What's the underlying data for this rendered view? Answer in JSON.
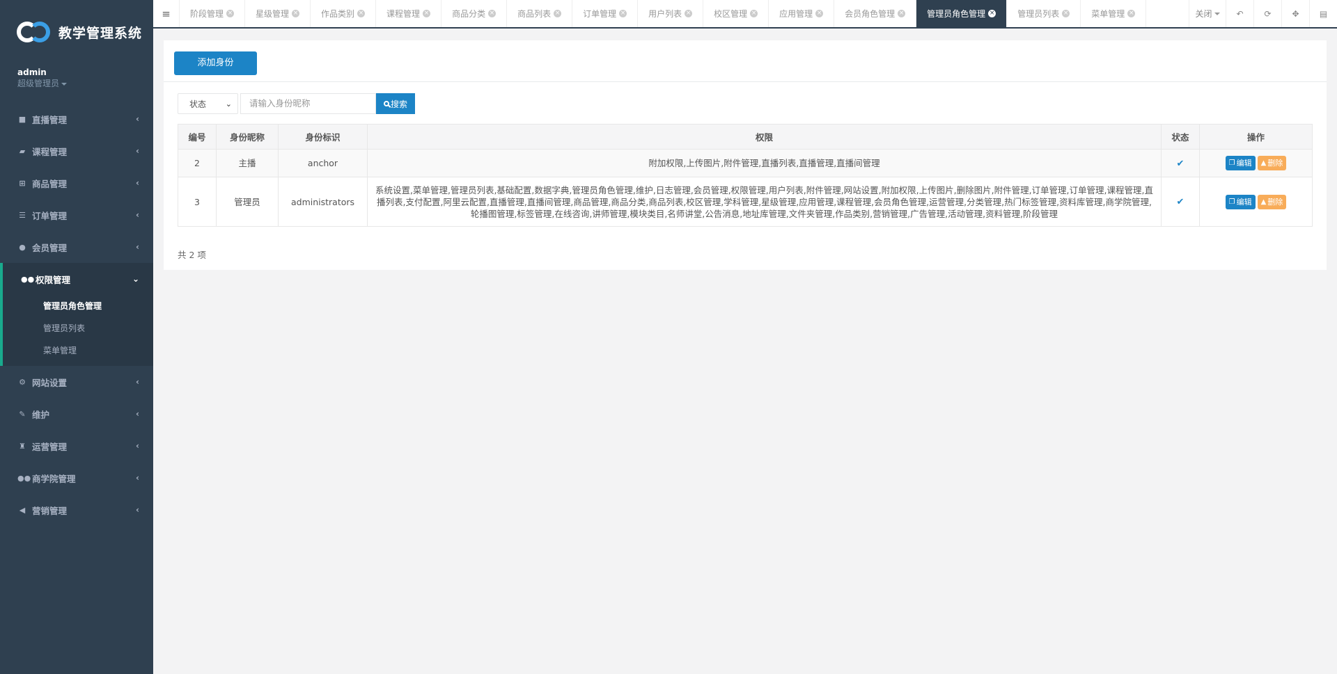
{
  "app": {
    "title": "教学管理系统"
  },
  "user": {
    "name": "admin",
    "role": "超级管理员"
  },
  "sidebar": {
    "items": [
      {
        "label": "直播管理",
        "icon": "video-icon"
      },
      {
        "label": "课程管理",
        "icon": "book-icon"
      },
      {
        "label": "商品管理",
        "icon": "cart-icon"
      },
      {
        "label": "订单管理",
        "icon": "list-icon"
      },
      {
        "label": "会员管理",
        "icon": "user-icon"
      },
      {
        "label": "权限管理",
        "icon": "users-icon"
      },
      {
        "label": "网站设置",
        "icon": "gear-icon"
      },
      {
        "label": "维护",
        "icon": "wrench-icon"
      },
      {
        "label": "运营管理",
        "icon": "trophy-icon"
      },
      {
        "label": "商学院管理",
        "icon": "group-icon"
      },
      {
        "label": "营销管理",
        "icon": "bullhorn-icon"
      }
    ],
    "submenu": [
      "管理员角色管理",
      "管理员列表",
      "菜单管理"
    ]
  },
  "tabs": [
    "阶段管理",
    "星级管理",
    "作品类别",
    "课程管理",
    "商品分类",
    "商品列表",
    "订单管理",
    "用户列表",
    "校区管理",
    "应用管理",
    "会员角色管理",
    "管理员角色管理",
    "管理员列表",
    "菜单管理"
  ],
  "toolbar": {
    "close_label": "关闭"
  },
  "main": {
    "add_button": "添加身份",
    "status_select": "状态",
    "search_placeholder": "请输入身份昵称",
    "search_button": "搜索",
    "columns": [
      "编号",
      "身份昵称",
      "身份标识",
      "权限",
      "状态",
      "操作"
    ],
    "rows": [
      {
        "id": "2",
        "name": "主播",
        "code": "anchor",
        "permissions": "附加权限,上传图片,附件管理,直播列表,直播管理,直播间管理"
      },
      {
        "id": "3",
        "name": "管理员",
        "code": "administrators",
        "permissions": "系统设置,菜单管理,管理员列表,基础配置,数据字典,管理员角色管理,维护,日志管理,会员管理,权限管理,用户列表,附件管理,网站设置,附加权限,上传图片,删除图片,附件管理,订单管理,订单管理,课程管理,直播列表,支付配置,阿里云配置,直播管理,直播间管理,商品管理,商品分类,商品列表,校区管理,学科管理,星级管理,应用管理,课程管理,会员角色管理,运营管理,分类管理,热门标签管理,资料库管理,商学院管理,轮播图管理,标签管理,在线咨询,讲师管理,模块类目,名师讲堂,公告消息,地址库管理,文件夹管理,作品类别,营销管理,广告管理,活动管理,资料管理,阶段管理"
      }
    ],
    "edit_label": "编辑",
    "delete_label": "删除",
    "total": "共 2 项"
  }
}
